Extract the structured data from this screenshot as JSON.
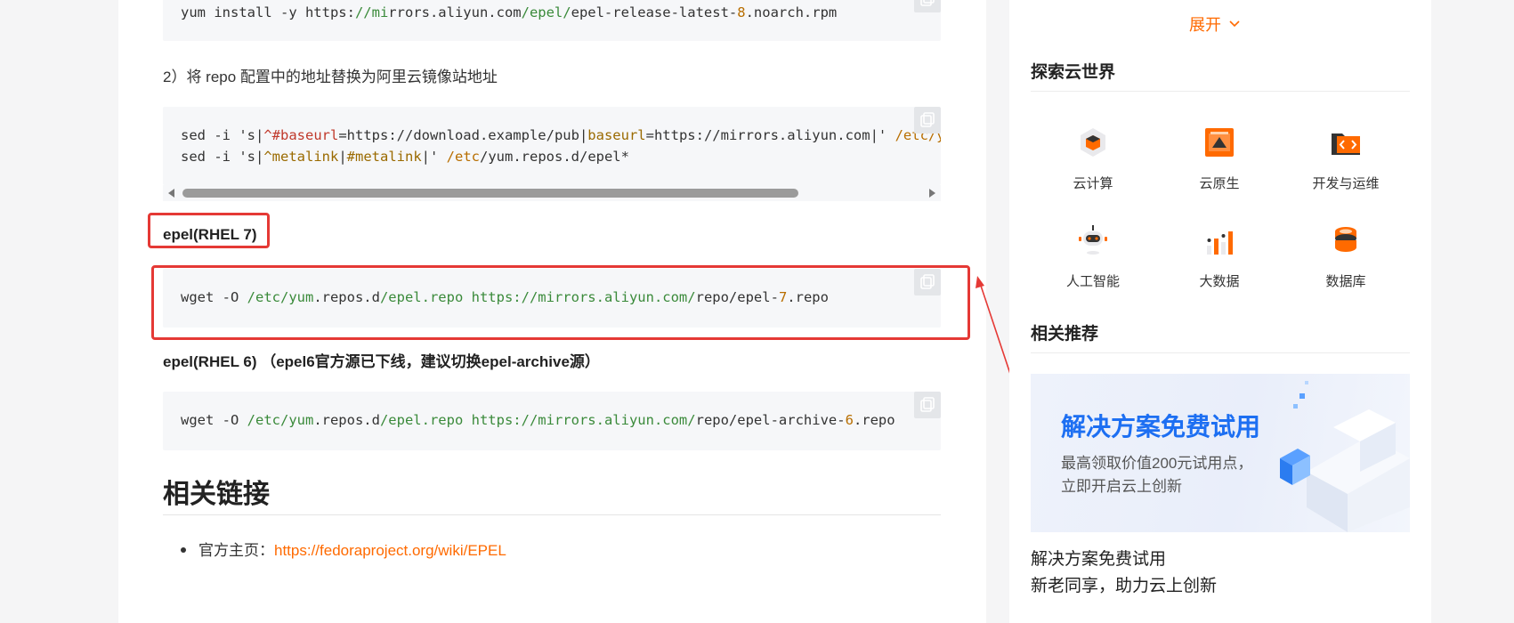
{
  "article": {
    "code_install": {
      "p1": "yum install -y https:",
      "p2": "//mi",
      "p3": "rrors.aliyun.com",
      "p4": "/epel/",
      "p5": "epel-release-latest-",
      "p6": "8",
      "p7": ".noarch.rpm"
    },
    "step2": "2）将 repo 配置中的地址替换为阿里云镜像站地址",
    "code_sed": {
      "l1": {
        "a": "sed -i 's|",
        "b": "^#baseurl",
        "c": "=https://download.example/pub|",
        "d": "baseurl",
        "e": "=https://mirrors.aliyun.com|' ",
        "f": "/etc/y"
      },
      "l2": {
        "a": "sed -i 's|",
        "b": "^metalink",
        "c": "|",
        "d": "#metalink",
        "e": "|' ",
        "f": "/etc",
        "g": "/yum.repos.d/epel*"
      }
    },
    "heading_rhel7": "epel(RHEL 7)",
    "code_rhel7": {
      "a": "wget -O ",
      "b": "/etc/yum",
      "c": ".repos.d",
      "d": "/epel.repo",
      "e": " ",
      "f": "https://mirrors.aliyun.com/",
      "g": "repo/epel-",
      "h": "7",
      "i": ".repo"
    },
    "heading_rhel6": "epel(RHEL 6) （epel6官方源已下线，建议切换epel-archive源）",
    "code_rhel6": {
      "a": "wget -O ",
      "b": "/etc/yum",
      "c": ".repos.d",
      "d": "/epel.repo",
      "e": " ",
      "f": "https://mirrors.aliyun.com/",
      "g": "repo/epel-archive-",
      "h": "6",
      "i": ".repo"
    },
    "links_heading": "相关链接",
    "homepage_label": "官方主页：",
    "homepage_url": "https://fedoraproject.org/wiki/EPEL"
  },
  "sidebar": {
    "expand_label": "展开",
    "explore_title": "探索云世界",
    "categories": [
      {
        "label": "云计算",
        "icon": "cube-icon"
      },
      {
        "label": "云原生",
        "icon": "container-icon"
      },
      {
        "label": "开发与运维",
        "icon": "folder-code-icon"
      },
      {
        "label": "人工智能",
        "icon": "robot-icon"
      },
      {
        "label": "大数据",
        "icon": "bar-chart-icon"
      },
      {
        "label": "数据库",
        "icon": "database-icon"
      }
    ],
    "recommend_title": "相关推荐",
    "banner": {
      "title": "解决方案免费试用",
      "subtitle_1": "最高领取价值200元试用点，",
      "subtitle_2": "立即开启云上创新"
    },
    "rec_line1": "解决方案免费试用",
    "rec_line2": "新老同享，助力云上创新"
  },
  "colors": {
    "accent": "#ff6a00",
    "annotation": "#e53935",
    "banner_title": "#1d6ff2"
  }
}
